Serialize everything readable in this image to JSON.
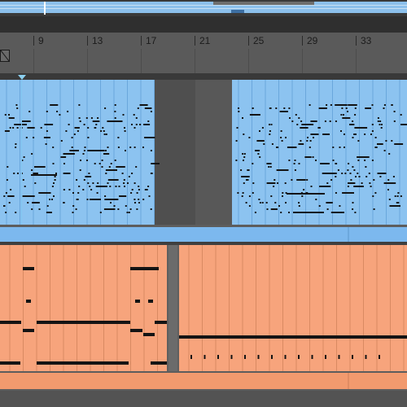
{
  "arrangement": {
    "ruler": {
      "bar_numbers": [
        "9",
        "13",
        "17",
        "21",
        "25",
        "29",
        "33"
      ]
    },
    "tracks": [
      {
        "name": "",
        "clip_color": "#8cc3f0",
        "header_color": "#7cb8ee"
      },
      {
        "name": "",
        "clip_color": "#f7a47c",
        "header_color": "#f29a6e"
      }
    ],
    "colors": {
      "note": "#141414",
      "background": "#5d5d5d"
    }
  }
}
